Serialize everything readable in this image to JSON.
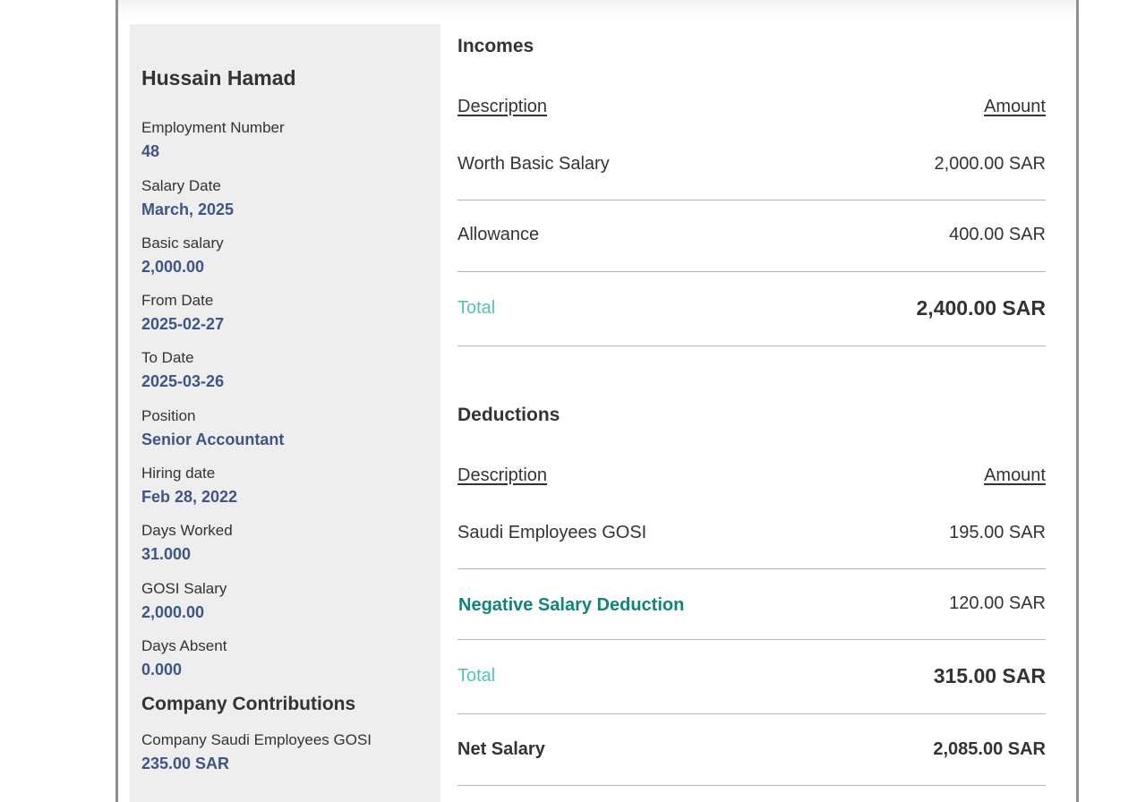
{
  "employee": {
    "name": "Hussain Hamad",
    "fields": [
      {
        "label": "Employment Number",
        "value": "48"
      },
      {
        "label": "Salary Date",
        "value": "March, 2025"
      },
      {
        "label": "Basic salary",
        "value": "2,000.00"
      },
      {
        "label": "From Date",
        "value": "2025-02-27"
      },
      {
        "label": "To Date",
        "value": "2025-03-26"
      },
      {
        "label": "Position",
        "value": "Senior Accountant"
      },
      {
        "label": "Hiring date",
        "value": "Feb 28, 2022"
      },
      {
        "label": "Days Worked",
        "value": "31.000"
      },
      {
        "label": "GOSI Salary",
        "value": "2,000.00"
      },
      {
        "label": "Days Absent",
        "value": "0.000"
      }
    ]
  },
  "company_contributions": {
    "heading": "Company Contributions",
    "items": [
      {
        "label": "Company Saudi Employees GOSI",
        "value": "235.00 SAR"
      }
    ]
  },
  "incomes": {
    "title": "Incomes",
    "col_description": "Description",
    "col_amount": "Amount",
    "rows": [
      {
        "description": "Worth Basic Salary",
        "amount": "2,000.00 SAR"
      },
      {
        "description": "Allowance",
        "amount": "400.00 SAR"
      }
    ],
    "total_label": "Total",
    "total_amount": "2,400.00 SAR"
  },
  "deductions": {
    "title": "Deductions",
    "col_description": "Description",
    "col_amount": "Amount",
    "rows": [
      {
        "description": "Saudi Employees GOSI",
        "amount": "195.00 SAR"
      },
      {
        "description": "Negative Salary Deduction",
        "amount": "120.00 SAR"
      }
    ],
    "total_label": "Total",
    "total_amount": "315.00 SAR"
  },
  "net_salary": {
    "label": "Net Salary",
    "amount": "2,085.00 SAR"
  },
  "colors": {
    "value_blue": "#3f5585",
    "total_teal": "#56c2b2",
    "link_teal": "#0f857a",
    "sidebar_bg": "#eeeeee"
  }
}
